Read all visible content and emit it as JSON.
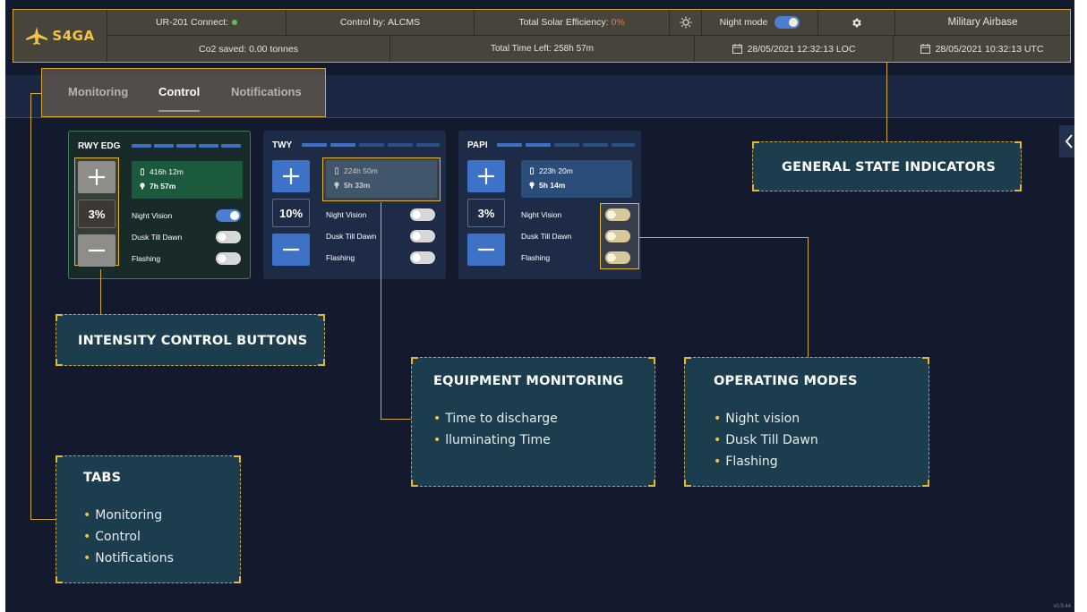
{
  "header": {
    "brand": "S4GA",
    "connection": "UR-201 Connect:",
    "connection_color": "#5fbf5f",
    "control_by": "Control by: ALCMS",
    "solar_label": "Total Solar Efficiency:",
    "solar_value": "0%",
    "night_mode_label": "Night mode",
    "night_mode_on": true,
    "location": "Military Airbase",
    "co2": "Co2 saved: 0.00 tonnes",
    "time_left": "Total Time Left: 258h 57m",
    "date_loc": "28/05/2021 12:32:13 LOC",
    "date_utc": "28/05/2021 10:32:13 UTC",
    "icons": [
      "brightness-icon",
      "gear-icon",
      "calendar-icon"
    ]
  },
  "tabs": [
    {
      "label": "Monitoring",
      "active": false
    },
    {
      "label": "Control",
      "active": true
    },
    {
      "label": "Notifications",
      "active": false
    }
  ],
  "cards": [
    {
      "title": "RWY EDG",
      "level_on": 5,
      "percent": "3%",
      "discharge": "416h 12m",
      "illuminating": "7h 57m",
      "modes": [
        {
          "label": "Night Vision",
          "state": "on"
        },
        {
          "label": "Dusk Till Dawn",
          "state": "off"
        },
        {
          "label": "Flashing",
          "state": "off"
        }
      ]
    },
    {
      "title": "TWY",
      "level_on": 2,
      "percent": "10%",
      "discharge": "224h 50m",
      "illuminating": "5h 33m",
      "modes": [
        {
          "label": "Night Vision",
          "state": "off"
        },
        {
          "label": "Dusk Till Dawn",
          "state": "off"
        },
        {
          "label": "Flashing",
          "state": "off"
        }
      ]
    },
    {
      "title": "PAPI",
      "level_on": 2,
      "percent": "3%",
      "discharge": "223h 20m",
      "illuminating": "5h 14m",
      "modes": [
        {
          "label": "Night Vision",
          "state": "off"
        },
        {
          "label": "Dusk Till Dawn",
          "state": "off"
        },
        {
          "label": "Flashing",
          "state": "off"
        }
      ]
    }
  ],
  "callouts": {
    "general": {
      "title": "GENERAL STATE INDICATORS"
    },
    "intensity": {
      "title": "INTENSITY CONTROL BUTTONS"
    },
    "equipment": {
      "title": "EQUIPMENT MONITORING",
      "items": [
        "Time to discharge",
        "lluminating Time"
      ]
    },
    "modes": {
      "title": "OPERATING MODES",
      "items": [
        "Night vision",
        "Dusk Till Dawn",
        "Flashing"
      ]
    },
    "tabs": {
      "title": "TABS",
      "items": [
        "Monitoring",
        "Control",
        "Notifications"
      ]
    }
  },
  "version": "v0.9.44",
  "colors": {
    "accent": "#d4a93a",
    "background": "#141a2d",
    "brand": "#f4c542",
    "toggle_on": "#4a7fd2",
    "solar_value": "#f07a3b"
  }
}
